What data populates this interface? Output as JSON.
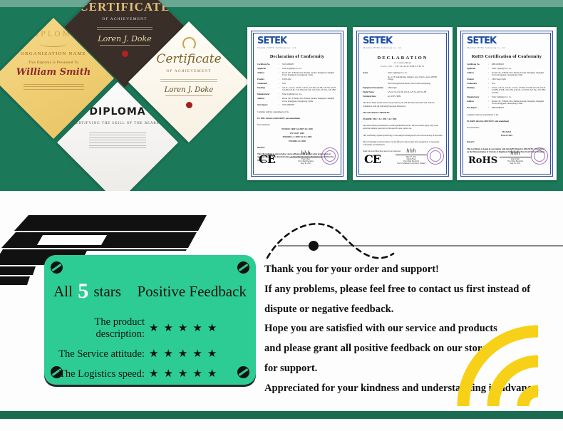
{
  "colors": {
    "dark_green": "#1b7859",
    "top_strip_green": "#6aa893",
    "mint_card": "#2dcc94",
    "accent_yellow": "#f7d117",
    "bottom_bar_green": "#1b6b52",
    "doc_blue": "#2f4fa0",
    "black": "#121212"
  },
  "top_section": {
    "name": "certificates-showcase",
    "diamonds": [
      {
        "id": "certificate-achievement-dark",
        "title": "CERTIFICATE",
        "subtitle": "OF ACHIEVEMENT",
        "signature": "Loren J. Doke",
        "seal": "red-wax-seal"
      },
      {
        "id": "diploma-gold",
        "title": "DIPLOMA",
        "organization": "ORGANIZATION NAME",
        "presented_to_label": "This Diploma is Presented To",
        "recipient": "William Smith",
        "body": "Lorem ipsum dolor sit amet, consectetur adipisicing elit, sed do eiusmod tempor incididunt ut labore et dolore magna aliqua."
      },
      {
        "id": "certificate-achievement-white",
        "title": "Certificate",
        "subtitle": "OF ACHIEVEMENT",
        "signature": "Loren J. Doke",
        "seal": "red-wax-seal"
      },
      {
        "id": "diploma-gray",
        "title": "DIPLOMA",
        "subtitle": "CERTIFYING THE SKILL OF THE BEARER",
        "body": "Lorem ipsum dolor sit amet, consectetur adipisicing elit, sed do eiusmod tempor incididunt ut labore et dolore magna aliqua."
      }
    ],
    "documents": [
      {
        "id": "declaration-of-conformity",
        "logo": "SETEK",
        "logo_sub": "Shenzhen SETEK Technology Co., Ltd",
        "title": "Declaration of Conformity",
        "fields": [
          {
            "key": "Certificate No.",
            "value": "SCE11080457"
          },
          {
            "key": "Applicant",
            "value": "Tider Lighting Ltd., Co."
          },
          {
            "key": "Address",
            "value": "Room 13C, E Build, New Pandan Garden, Shanghai, Chenghai Town, Dongguan, Guangdong, China"
          },
          {
            "key": "Product",
            "value": "LED Light"
          },
          {
            "key": "Trademark",
            "value": "N/A"
          },
          {
            "key": "Model(s)",
            "value": "GY-1L, GY-2L, GY-3L, GY-5L, GY-5W, GY-5B, GY-7W, GY-7L, GY-9W, GY-9L, GY-12W, GY-12L, GY-15W, GY-15L, GY-18W"
          },
          {
            "key": "Manufacturer",
            "value": "Tider Lighting Ltd., Co."
          },
          {
            "key": "Address",
            "value": "Room 13C, E Build, New Pandan Garden, Shanghai, Chenghai Town, Dongguan, Guangdong, China"
          },
          {
            "key": "Test Report",
            "value": "SCE11080438"
          }
        ],
        "complies_label": "Complies with the requirements of the",
        "directive": "EC EMC directive 2004/108/EC and amendment",
        "standards_label": "Test Standards:",
        "standards": [
          "EN55015: 2006+A1:2007+A2: 2009",
          "EN 61547: 2009",
          "EN61000-3-2: 2006+A1:A2: 2009",
          "EN61000-3-3: 2008"
        ],
        "remark_label": "Remark:",
        "remark": "The CE marking as shown below can be affixed on the product after preparation of necessary conformity documentation, as described in article 10 of the Council Directive 93/68/EEC.",
        "mark": "CE",
        "signer": "Peter Chen",
        "signer_title": "Vice Chief Executive",
        "date": "Aug. 30, 2011"
      },
      {
        "id": "declaration-of-conformity-2",
        "logo": "SETEK",
        "logo_sub": "Shenzhen SETEK Technology Co., Ltd",
        "title": "DECLARATION",
        "title_line2": "of Conformity",
        "title_line3": "Certi. No.: 1471210407048/LVD/11",
        "fields": [
          {
            "key": "Issuer",
            "value": "Tider Lighting Ltd., Co."
          },
          {
            "key": "",
            "value": "No. 13 E Guild Range, industry, area, Nan Lo-zont, SETEK village"
          },
          {
            "key": "",
            "value": "Fu-Fu xiang Baoshi district Nova Chan Guangdong"
          },
          {
            "key": "Equipment Description",
            "value": "LED Light"
          },
          {
            "key": "Model Name",
            "value": "GY-A1 5L-GW 5L-GY-3L-GY-7L-GW-5L-3B"
          },
          {
            "key": "Technical Data",
            "value": "AC 230V, 50Hz"
          }
        ],
        "para1": "The above listed products have been tested by us with the listed standards and found in compliance with the following European Directives:",
        "directive": "The LVD directive 2006/95/EC",
        "standards": "EN 60598: 1993 + A1: 1993 + A2: 1995",
        "para2": "The stated marks performed in a normal permission mode. The test results apply only to the particular sample tested and to the specific tests carried out.",
        "para3": "This conformity applies specifically to the sample investigated in our test laboratory in that time.",
        "para4": "The CE marking as shown below can be affixed to the product after preparation of necessary conformity documentation.",
        "para5": "Other relevant Directives need to be observed.",
        "mark": "CE",
        "date": "May 07, 2011",
        "signer": "Daniel Yuan",
        "signer_title": "Vice Chief Executive",
        "lab": "Nova Compliance Laboratory Limited"
      },
      {
        "id": "rohs-certification-of-conformity",
        "logo": "SETEK",
        "logo_sub": "Shenzhen SETEK Technology Co., Ltd",
        "title": "RoHS Certification of Conformity",
        "fields": [
          {
            "key": "Certificate No.",
            "value": "RHS11080435"
          },
          {
            "key": "Applicant",
            "value": "Tider Lighting Ltd., Co."
          },
          {
            "key": "Address",
            "value": "Room 13C, E Build, New Pandan Garden, Shanghai, Chenghai Town, Dongguan, Guangdong, China"
          },
          {
            "key": "Product",
            "value": "LED Stage Light"
          },
          {
            "key": "Trademark",
            "value": "N/A"
          },
          {
            "key": "Model(s)",
            "value": "GY-1L, GY-2L, GY-3L, GY-5L, GY-5W, GY-5B, GY-7W, GY-7L, GY-9W, GY-9L, GY-12W, GY-12L, GY-15W, GY-15L, GY-18W, GY-18L"
          },
          {
            "key": "Manufacturer",
            "value": "Tider Lighting Ltd., Co."
          },
          {
            "key": "Address",
            "value": "Room 13C, E Build, New Pandan Garden, Shanghai, Chenghai Town, Dongguan, Guangdong, China"
          },
          {
            "key": "Test Report",
            "value": "RHS11080435"
          }
        ],
        "complies_label": "Complies with the requirements of the",
        "directive": "EC RoHS directive 2002/95/EC and amendment",
        "standards_label": "Test Standards:",
        "standards": [
          "IEC62321",
          "EN1122:2001"
        ],
        "remark_label": "Remark:",
        "remark": "This Certificate is issued in accordance with the RoHS Directive 2002/95/EC. Procedures on the Harmonization of Circuits of Regulated Substances in Electrical Electric Products.",
        "mark": "RoHS",
        "signer": "Peter Chen",
        "signer_title": "Vice Chief Executive",
        "date": "Aug. 30, 2011"
      }
    ]
  },
  "feedback": {
    "card": {
      "heading_pre": "All",
      "heading_number": "5",
      "heading_mid": "stars",
      "heading_post": "Positive Feedback",
      "ratings": [
        {
          "label": "The product description:",
          "stars": 5
        },
        {
          "label": "The Service attitude:",
          "stars": 5
        },
        {
          "label": "The Logistics speed:",
          "stars": 5
        }
      ],
      "star_glyph": "★",
      "screws": [
        "screw-top-left",
        "screw-top-right",
        "screw-bottom-left",
        "screw-bottom-right"
      ]
    },
    "message_lines": [
      "Thank you for your order and support!",
      "If any problems, please feel free to contact us first instead of",
      "dispute or negative feedback.",
      "Hope you are satisfied with our service and products",
      "and please grant all positive feedback on our store",
      "for support.",
      "Appreciated for your kindness and understanding in advance."
    ]
  },
  "decorations": {
    "ribbon": "black-angled-ribbon",
    "swoosh": "dashed-s-curve-with-dot",
    "wifi_arcs": "yellow-concentric-arcs",
    "bottom_bar": "green-footer-bar"
  }
}
